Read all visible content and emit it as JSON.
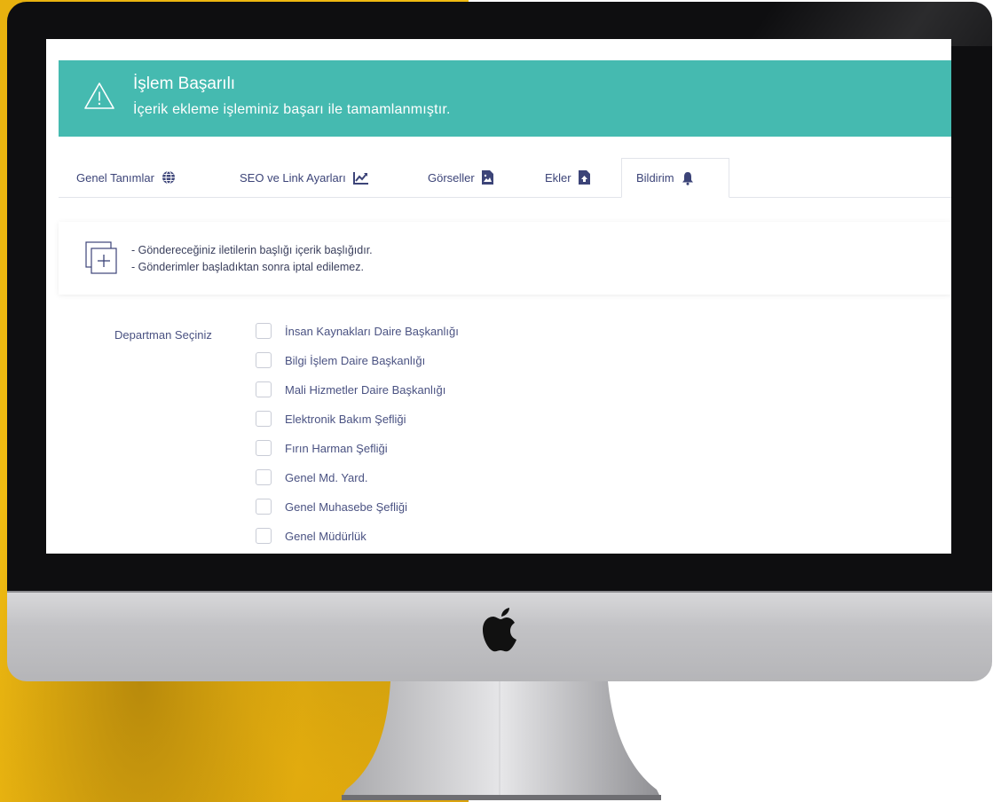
{
  "alert": {
    "title": "İşlem Başarılı",
    "message": "İçerik ekleme işleminiz başarı ile tamamlanmıştır.",
    "color": "#45bab0"
  },
  "tabs": [
    {
      "label": "Genel Tanımlar",
      "icon": "globe-icon"
    },
    {
      "label": "SEO ve Link Ayarları",
      "icon": "chart-line-icon"
    },
    {
      "label": "Görseller",
      "icon": "image-file-icon"
    },
    {
      "label": "Ekler",
      "icon": "file-upload-icon"
    },
    {
      "label": "Bildirim",
      "icon": "bell-icon",
      "active": true
    }
  ],
  "info": {
    "icon": "add-copy-icon",
    "lines": [
      "- Göndereceğiniz iletilerin başlığı içerik başlığıdır.",
      "- Gönderimler başladıktan sonra iptal edilemez."
    ]
  },
  "department": {
    "label": "Departman Seçiniz",
    "options": [
      {
        "label": "İnsan Kaynakları Daire Başkanlığı",
        "checked": false
      },
      {
        "label": "Bilgi İşlem Daire Başkanlığı",
        "checked": false
      },
      {
        "label": "Mali Hizmetler Daire Başkanlığı",
        "checked": false
      },
      {
        "label": "Elektronik Bakım Şefliği",
        "checked": false
      },
      {
        "label": "Fırın Harman Şefliği",
        "checked": false
      },
      {
        "label": "Genel Md. Yard.",
        "checked": false
      },
      {
        "label": "Genel Muhasebe Şefliği",
        "checked": false
      },
      {
        "label": "Genel Müdürlük",
        "checked": false
      }
    ]
  },
  "colors": {
    "text_primary": "#3c4478",
    "backdrop_accent": "#f2bd12"
  }
}
